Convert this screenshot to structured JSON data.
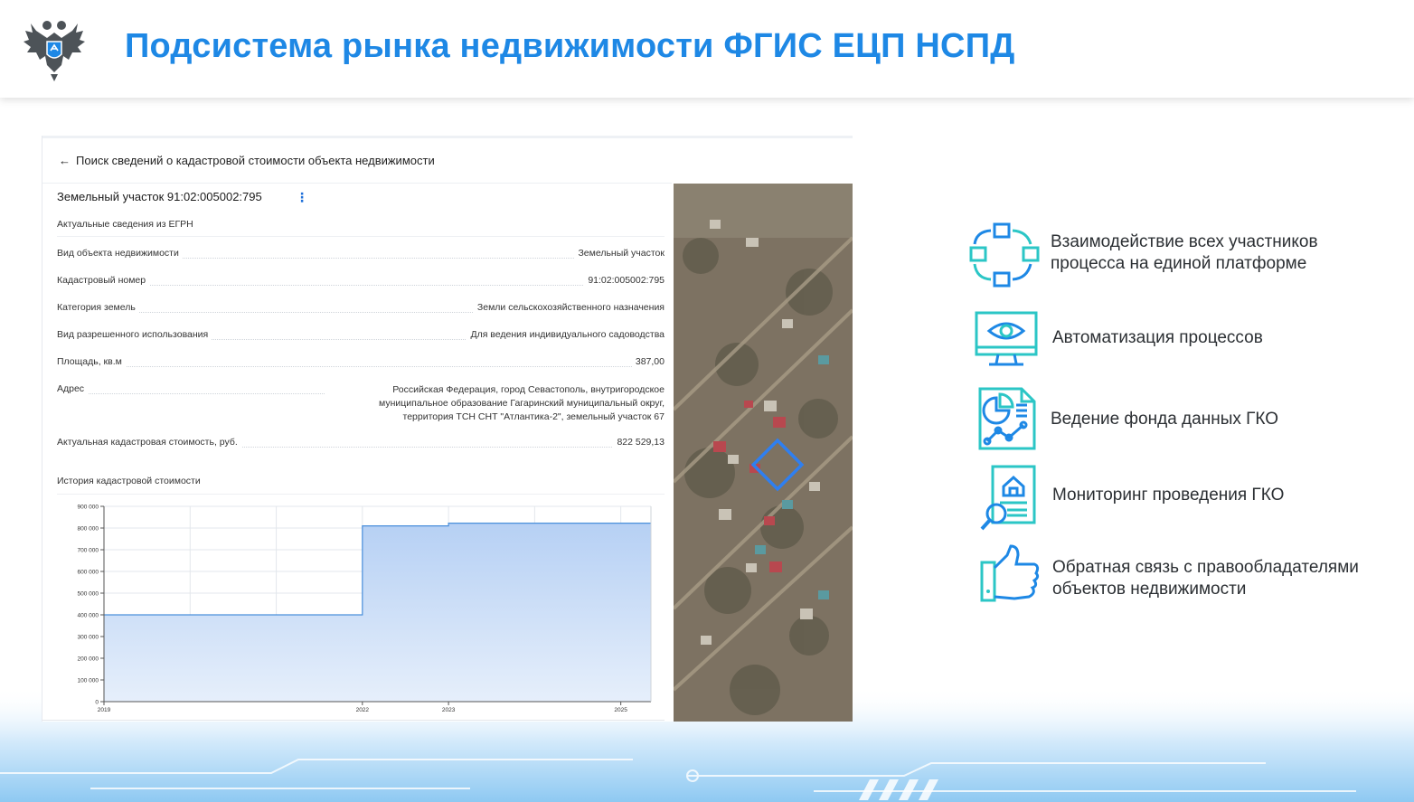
{
  "header": {
    "title": "Подсистема рынка недвижимости ФГИС ЕЦП НСПД"
  },
  "panel": {
    "back_label": "Поиск сведений о кадастровой стоимости объекта недвижимости",
    "parcel_title": "Земельный участок 91:02:005002:795",
    "section_label": "Актуальные сведения из ЕГРН",
    "rows": [
      {
        "label": "Вид объекта недвижимости",
        "value": "Земельный участок"
      },
      {
        "label": "Кадастровый номер",
        "value": "91:02:005002:795"
      },
      {
        "label": "Категория земель",
        "value": "Земли сельскохозяйственного назначения"
      },
      {
        "label": "Вид разрешенного использования",
        "value": "Для ведения индивидуального садоводства"
      },
      {
        "label": "Площадь, кв.м",
        "value": "387,00"
      }
    ],
    "address": {
      "label": "Адрес",
      "value": "Российская Федерация, город Севастополь, внутригородское муниципальное образование Гагаринский муниципальный округ, территория ТСН СНТ \"Атлантика-2\", земельный участок 67"
    },
    "current_value": {
      "label": "Актуальная кадастровая стоимость, руб.",
      "value": "822 529,13"
    },
    "history_label": "История кадастровой стоимости"
  },
  "chart_data": {
    "type": "area",
    "step": true,
    "x": [
      2019,
      2022,
      2022.99,
      2023,
      2025.35
    ],
    "y": [
      400000,
      810000,
      810000,
      822529,
      822529
    ],
    "xlim": [
      2019,
      2025.35
    ],
    "ylim": [
      0,
      900000
    ],
    "x_ticks": [
      2019,
      2022,
      2023,
      2025
    ],
    "x_tick_labels": [
      "2019",
      "2022",
      "2023",
      "2025"
    ],
    "y_ticks": [
      0,
      100000,
      200000,
      300000,
      400000,
      500000,
      600000,
      700000,
      800000,
      900000
    ],
    "y_tick_labels": [
      "0",
      "100 000",
      "200 000",
      "300 000",
      "400 000",
      "500 000",
      "600 000",
      "700 000",
      "800 000",
      "900 000"
    ],
    "grid": true,
    "color": "#4a8fdb"
  },
  "features": [
    {
      "icon": "cycle-arrows-icon",
      "lines": [
        "Взаимодействие всех участников",
        "процесса на единой платформе"
      ]
    },
    {
      "icon": "monitor-eye-icon",
      "lines": [
        "Автоматизация процессов"
      ]
    },
    {
      "icon": "document-chart-icon",
      "lines": [
        "Ведение фонда данных ГКО"
      ]
    },
    {
      "icon": "document-magnifier-icon",
      "lines": [
        "Мониторинг проведения ГКО"
      ]
    },
    {
      "icon": "thumbs-up-icon",
      "lines": [
        "Обратная связь с правообладателями",
        "объектов недвижимости"
      ]
    }
  ]
}
